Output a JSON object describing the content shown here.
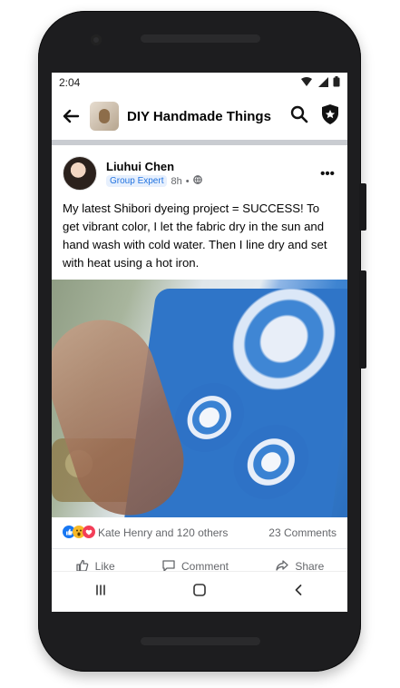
{
  "status": {
    "time": "2:04"
  },
  "header": {
    "title": "DIY Handmade Things"
  },
  "post": {
    "author": "Liuhui Chen",
    "badge": "Group Expert",
    "time": "8h",
    "separator": "•",
    "text": "My latest Shibori dyeing project = SUCCESS!  To get vibrant color, I let the fabric dry in the sun and hand wash with cold water. Then I line dry and set with heat using a hot iron.",
    "reactions_text": "Kate Henry and 120 others",
    "comments_text": "23 Comments"
  },
  "actions": {
    "like": "Like",
    "comment": "Comment",
    "share": "Share"
  },
  "icons": {
    "back": "back-arrow-icon",
    "search": "search-icon",
    "shield": "shield-star-icon",
    "more": "more-icon",
    "globe": "globe-icon",
    "like": "like-icon",
    "wow": "wow-icon",
    "love": "love-icon",
    "android_recents": "recents-icon",
    "android_home": "home-icon",
    "android_back": "nav-back-icon"
  },
  "colors": {
    "brand": "#1877f2",
    "badge_bg": "#e7f0fd",
    "badge_text": "#2374e1"
  }
}
